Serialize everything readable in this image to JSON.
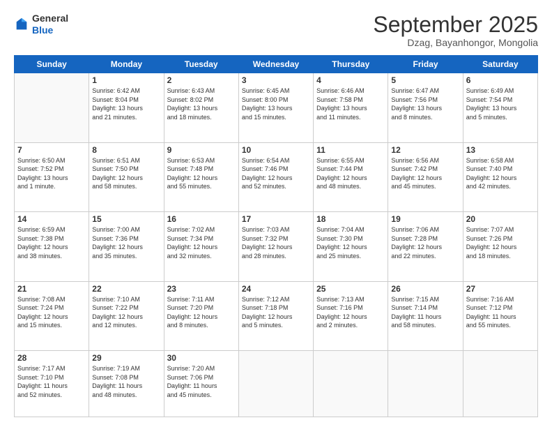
{
  "logo": {
    "general": "General",
    "blue": "Blue"
  },
  "header": {
    "month": "September 2025",
    "location": "Dzag, Bayanhongor, Mongolia"
  },
  "days_of_week": [
    "Sunday",
    "Monday",
    "Tuesday",
    "Wednesday",
    "Thursday",
    "Friday",
    "Saturday"
  ],
  "weeks": [
    [
      {
        "day": null,
        "info": null
      },
      {
        "day": "1",
        "info": "Sunrise: 6:42 AM\nSunset: 8:04 PM\nDaylight: 13 hours\nand 21 minutes."
      },
      {
        "day": "2",
        "info": "Sunrise: 6:43 AM\nSunset: 8:02 PM\nDaylight: 13 hours\nand 18 minutes."
      },
      {
        "day": "3",
        "info": "Sunrise: 6:45 AM\nSunset: 8:00 PM\nDaylight: 13 hours\nand 15 minutes."
      },
      {
        "day": "4",
        "info": "Sunrise: 6:46 AM\nSunset: 7:58 PM\nDaylight: 13 hours\nand 11 minutes."
      },
      {
        "day": "5",
        "info": "Sunrise: 6:47 AM\nSunset: 7:56 PM\nDaylight: 13 hours\nand 8 minutes."
      },
      {
        "day": "6",
        "info": "Sunrise: 6:49 AM\nSunset: 7:54 PM\nDaylight: 13 hours\nand 5 minutes."
      }
    ],
    [
      {
        "day": "7",
        "info": "Sunrise: 6:50 AM\nSunset: 7:52 PM\nDaylight: 13 hours\nand 1 minute."
      },
      {
        "day": "8",
        "info": "Sunrise: 6:51 AM\nSunset: 7:50 PM\nDaylight: 12 hours\nand 58 minutes."
      },
      {
        "day": "9",
        "info": "Sunrise: 6:53 AM\nSunset: 7:48 PM\nDaylight: 12 hours\nand 55 minutes."
      },
      {
        "day": "10",
        "info": "Sunrise: 6:54 AM\nSunset: 7:46 PM\nDaylight: 12 hours\nand 52 minutes."
      },
      {
        "day": "11",
        "info": "Sunrise: 6:55 AM\nSunset: 7:44 PM\nDaylight: 12 hours\nand 48 minutes."
      },
      {
        "day": "12",
        "info": "Sunrise: 6:56 AM\nSunset: 7:42 PM\nDaylight: 12 hours\nand 45 minutes."
      },
      {
        "day": "13",
        "info": "Sunrise: 6:58 AM\nSunset: 7:40 PM\nDaylight: 12 hours\nand 42 minutes."
      }
    ],
    [
      {
        "day": "14",
        "info": "Sunrise: 6:59 AM\nSunset: 7:38 PM\nDaylight: 12 hours\nand 38 minutes."
      },
      {
        "day": "15",
        "info": "Sunrise: 7:00 AM\nSunset: 7:36 PM\nDaylight: 12 hours\nand 35 minutes."
      },
      {
        "day": "16",
        "info": "Sunrise: 7:02 AM\nSunset: 7:34 PM\nDaylight: 12 hours\nand 32 minutes."
      },
      {
        "day": "17",
        "info": "Sunrise: 7:03 AM\nSunset: 7:32 PM\nDaylight: 12 hours\nand 28 minutes."
      },
      {
        "day": "18",
        "info": "Sunrise: 7:04 AM\nSunset: 7:30 PM\nDaylight: 12 hours\nand 25 minutes."
      },
      {
        "day": "19",
        "info": "Sunrise: 7:06 AM\nSunset: 7:28 PM\nDaylight: 12 hours\nand 22 minutes."
      },
      {
        "day": "20",
        "info": "Sunrise: 7:07 AM\nSunset: 7:26 PM\nDaylight: 12 hours\nand 18 minutes."
      }
    ],
    [
      {
        "day": "21",
        "info": "Sunrise: 7:08 AM\nSunset: 7:24 PM\nDaylight: 12 hours\nand 15 minutes."
      },
      {
        "day": "22",
        "info": "Sunrise: 7:10 AM\nSunset: 7:22 PM\nDaylight: 12 hours\nand 12 minutes."
      },
      {
        "day": "23",
        "info": "Sunrise: 7:11 AM\nSunset: 7:20 PM\nDaylight: 12 hours\nand 8 minutes."
      },
      {
        "day": "24",
        "info": "Sunrise: 7:12 AM\nSunset: 7:18 PM\nDaylight: 12 hours\nand 5 minutes."
      },
      {
        "day": "25",
        "info": "Sunrise: 7:13 AM\nSunset: 7:16 PM\nDaylight: 12 hours\nand 2 minutes."
      },
      {
        "day": "26",
        "info": "Sunrise: 7:15 AM\nSunset: 7:14 PM\nDaylight: 11 hours\nand 58 minutes."
      },
      {
        "day": "27",
        "info": "Sunrise: 7:16 AM\nSunset: 7:12 PM\nDaylight: 11 hours\nand 55 minutes."
      }
    ],
    [
      {
        "day": "28",
        "info": "Sunrise: 7:17 AM\nSunset: 7:10 PM\nDaylight: 11 hours\nand 52 minutes."
      },
      {
        "day": "29",
        "info": "Sunrise: 7:19 AM\nSunset: 7:08 PM\nDaylight: 11 hours\nand 48 minutes."
      },
      {
        "day": "30",
        "info": "Sunrise: 7:20 AM\nSunset: 7:06 PM\nDaylight: 11 hours\nand 45 minutes."
      },
      {
        "day": null,
        "info": null
      },
      {
        "day": null,
        "info": null
      },
      {
        "day": null,
        "info": null
      },
      {
        "day": null,
        "info": null
      }
    ]
  ]
}
